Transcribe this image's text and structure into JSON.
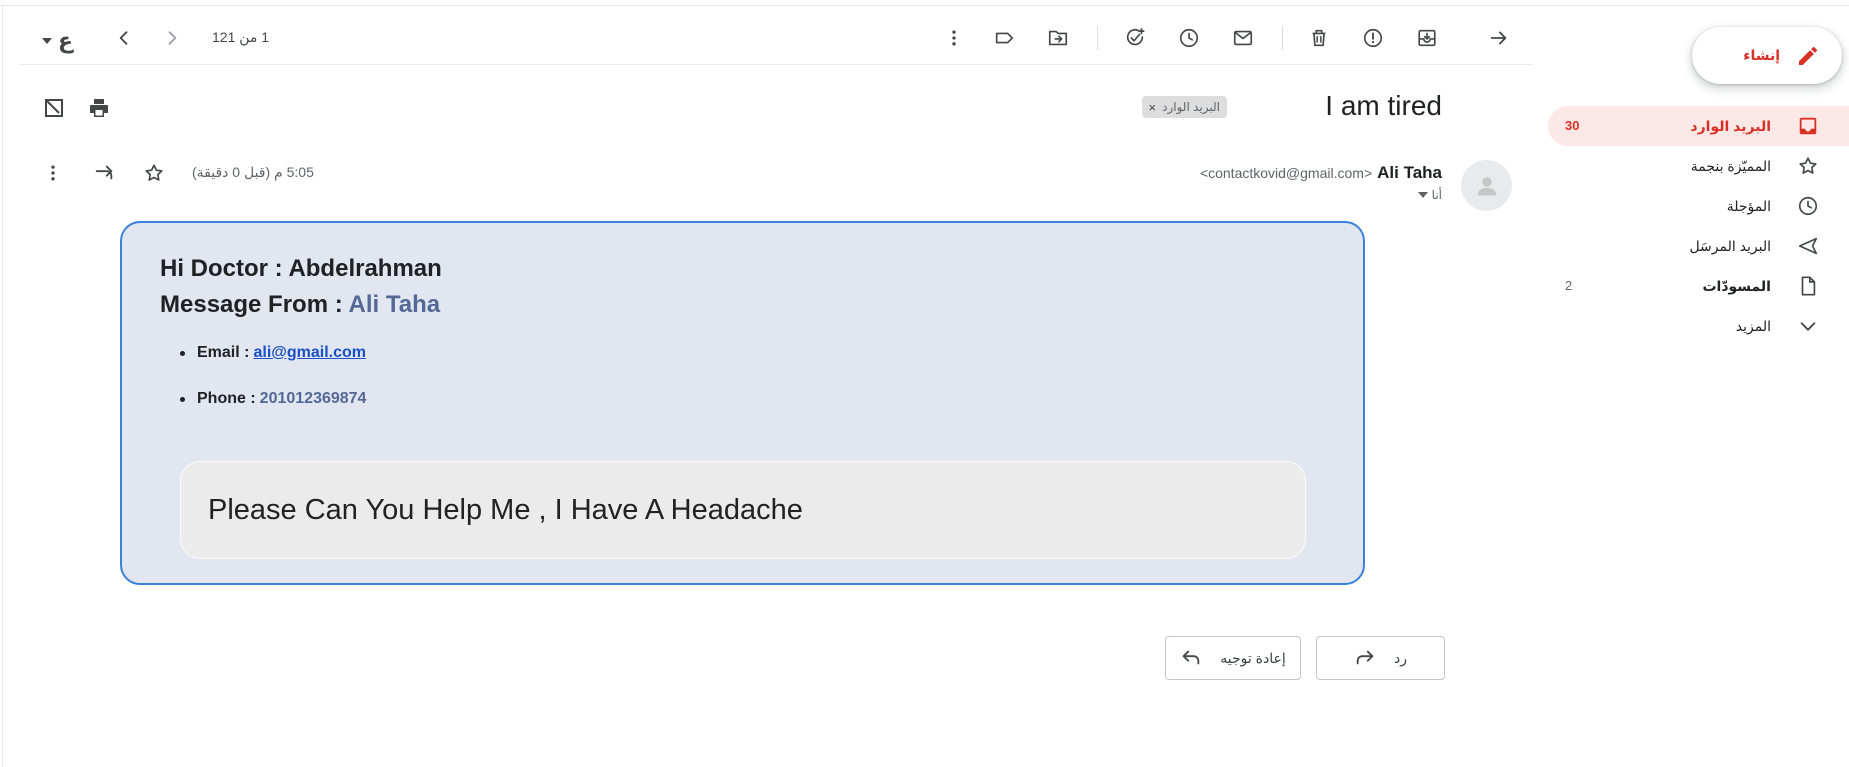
{
  "sidebar": {
    "compose_label": "إنشاء",
    "items": [
      {
        "label": "البريد الوارد",
        "count": "30"
      },
      {
        "label": "المميّزة بنجمة",
        "count": ""
      },
      {
        "label": "المؤجلة",
        "count": ""
      },
      {
        "label": "البريد المرسَل",
        "count": ""
      },
      {
        "label": "المسودّات",
        "count": "2"
      },
      {
        "label": "المزيد",
        "count": ""
      }
    ]
  },
  "toolbar": {
    "pager_text": "1 من 121",
    "language_glyph": "ع"
  },
  "email": {
    "subject": "I am tired",
    "label_chip": "البريد الوارد",
    "chip_close": "×",
    "sender_name": "Ali Taha",
    "sender_email": "<contactkovid@gmail.com>",
    "to_text": "أنا",
    "time_text": "5:05 م (قبل 0 دقيقة)"
  },
  "body": {
    "greeting_prefix": "Hi Doctor : ",
    "greeting_name": "Abdelrahman",
    "from_prefix": "Message From : ",
    "from_name": "Ali Taha",
    "email_label": "Email :",
    "email_value": "ali@gmail.com",
    "phone_label": "Phone :",
    "phone_value": "201012369874",
    "message": "Please Can You Help Me , I Have A Headache"
  },
  "actions": {
    "reply_label": "رد",
    "forward_label": "إعادة توجيه"
  },
  "colors": {
    "accent_red": "#d93025",
    "active_bg": "#fce8e6",
    "card_bg": "#e1e6f0",
    "card_border": "#3b82dd",
    "link_blue": "#1a4fc6",
    "highlight_text": "#536896"
  }
}
